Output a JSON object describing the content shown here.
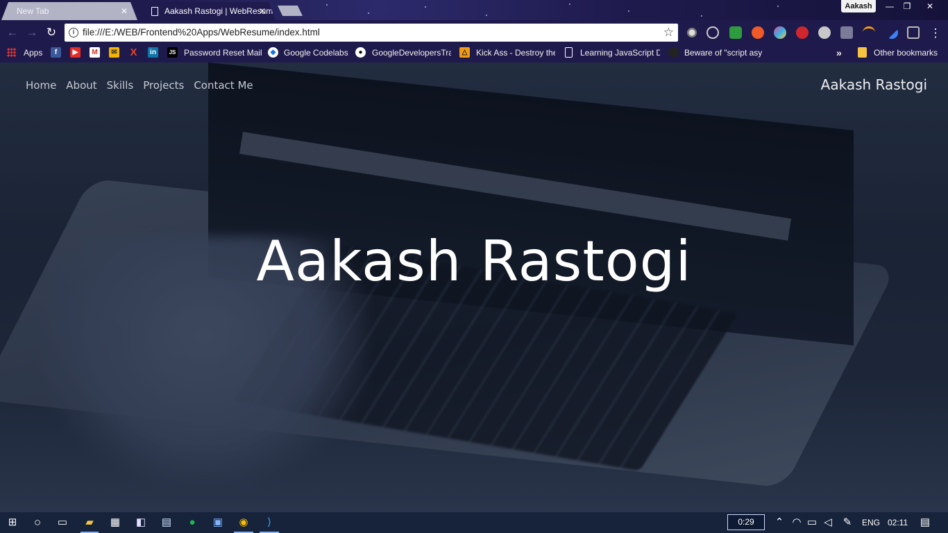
{
  "browser": {
    "tabs": [
      {
        "label": "New Tab",
        "active": false
      },
      {
        "label": "Aakash Rastogi | WebResume",
        "active": true
      }
    ],
    "profile_name": "Aakash",
    "address": "file:///E:/WEB/Frontend%20Apps/WebResume/index.html",
    "bookmarks": [
      {
        "label": "Apps",
        "icon": "apps-grid-icon"
      },
      {
        "label": "Password Reset Mail",
        "icon": "js-icon"
      },
      {
        "label": "Google Codelabs",
        "icon": "codelabs-icon"
      },
      {
        "label": "GoogleDevelopersTra",
        "icon": "github-icon"
      },
      {
        "label": "Kick Ass - Destroy the",
        "icon": "kickass-icon"
      },
      {
        "label": "Learning JavaScript D",
        "icon": "page-icon"
      },
      {
        "label": "Beware of \"script asy",
        "icon": "github-icon"
      }
    ],
    "overflow_label": "»",
    "other_bookmarks": "Other bookmarks"
  },
  "site": {
    "nav": [
      "Home",
      "About",
      "Skills",
      "Projects",
      "Contact Me"
    ],
    "brand": "Aakash Rastogi",
    "hero_title": "Aakash Rastogi"
  },
  "taskbar": {
    "timer": "0:29",
    "language": "ENG",
    "clock": "02:11"
  },
  "colors": {
    "chrome_frame": "#1f1a4c",
    "taskbar": "#17233b",
    "hero_text": "#ffffff"
  }
}
